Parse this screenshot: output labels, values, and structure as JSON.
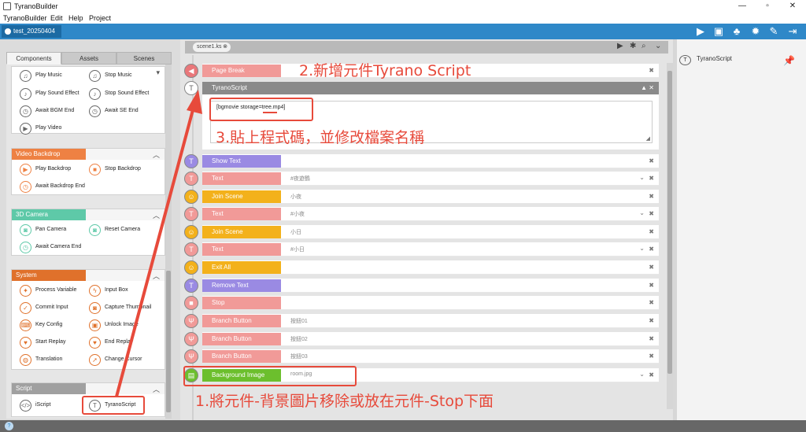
{
  "window": {
    "title": "TyranoBuilder",
    "minimize": "—",
    "maximize": "▫",
    "close": "✕"
  },
  "menu": [
    "TyranoBuilder",
    "Edit",
    "Help",
    "Project"
  ],
  "project": {
    "name": "test_20250404",
    "toolbar_icons": [
      "play-icon",
      "save-icon",
      "characters-icon",
      "settings-icon",
      "build-icon",
      "export-icon"
    ]
  },
  "left_tabs": [
    "Components",
    "Assets",
    "Scenes"
  ],
  "categories": [
    {
      "title": "",
      "color": "#ffffff",
      "items": [
        "Play Music",
        "Stop Music",
        "Play Sound Effect",
        "Stop Sound Effect",
        "Await BGM End",
        "Await SE End",
        "Play Video"
      ]
    },
    {
      "title": "Video Backdrop",
      "color": "#ee8143",
      "items": [
        "Play Backdrop",
        "Stop Backdrop",
        "Await Backdrop End"
      ]
    },
    {
      "title": "3D Camera",
      "color": "#5ec9a8",
      "items": [
        "Pan Camera",
        "Reset Camera",
        "Await Camera End"
      ]
    },
    {
      "title": "System",
      "color": "#e0712b",
      "items": [
        "Process Variable",
        "Input Box",
        "Commit Input",
        "Capture Thumbnail",
        "Key Config",
        "Unlock Image",
        "Start Replay",
        "End Replay",
        "Translation",
        "Change Cursor"
      ]
    },
    {
      "title": "Script",
      "color": "#a0a0a0",
      "items": [
        "iScript",
        "TyranoScript"
      ]
    }
  ],
  "scene": {
    "tab": "scene1.ks",
    "close": "⊗"
  },
  "timeline": [
    {
      "label": "Page Break",
      "color": "#f19a98",
      "node": "#e9777a",
      "param": "",
      "dropdown": false
    },
    {
      "label": "TyranoScript",
      "color": "#8a8a8a",
      "node": "#ffffff",
      "param": "",
      "dropdown": false
    },
    {
      "label": "Show Text",
      "color": "#9a8ae3",
      "node": "#9a8ae3",
      "param": "",
      "dropdown": false
    },
    {
      "label": "Text",
      "color": "#f19a98",
      "node": "#f19a98",
      "param": "#夜遊鶴",
      "dropdown": true
    },
    {
      "label": "Join Scene",
      "color": "#f3b11b",
      "node": "#f3b11b",
      "param": "小夜",
      "dropdown": false
    },
    {
      "label": "Text",
      "color": "#f19a98",
      "node": "#f19a98",
      "param": "#小夜",
      "dropdown": true
    },
    {
      "label": "Join Scene",
      "color": "#f3b11b",
      "node": "#f3b11b",
      "param": "小日",
      "dropdown": false
    },
    {
      "label": "Text",
      "color": "#f19a98",
      "node": "#f19a98",
      "param": "#小日",
      "dropdown": true
    },
    {
      "label": "Exit All",
      "color": "#f3b11b",
      "node": "#f3b11b",
      "param": "",
      "dropdown": false
    },
    {
      "label": "Remove Text",
      "color": "#9a8ae3",
      "node": "#9a8ae3",
      "param": "",
      "dropdown": false
    },
    {
      "label": "Stop",
      "color": "#f19a98",
      "node": "#f19a98",
      "param": "",
      "dropdown": false
    },
    {
      "label": "Branch Button",
      "color": "#f19a98",
      "node": "#f19a98",
      "param": "按鈕01",
      "dropdown": false
    },
    {
      "label": "Branch Button",
      "color": "#f19a98",
      "node": "#f19a98",
      "param": "按鈕02",
      "dropdown": false
    },
    {
      "label": "Branch Button",
      "color": "#f19a98",
      "node": "#f19a98",
      "param": "按鈕03",
      "dropdown": false
    },
    {
      "label": "Background Image",
      "color": "#6cbf2d",
      "node": "#6cbf2d",
      "param": "room.jpg",
      "dropdown": true
    }
  ],
  "tyranoscript": {
    "code": "[bgmovie storage=tree.mp4]",
    "controls": "▲ ✕"
  },
  "right_panel": {
    "item": "TyranoScript"
  },
  "annotations": {
    "a1": "1.將元件-背景圖片移除或放在元件-Stop下面",
    "a2": "2.新增元件Tyrano Script",
    "a3": "3.貼上程式碼，並修改檔案名稱"
  }
}
